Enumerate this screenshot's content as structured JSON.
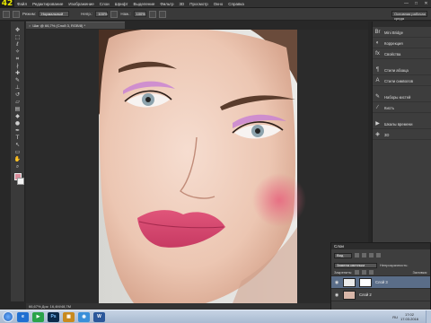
{
  "menubar": {
    "logo": "42",
    "items": [
      "Файл",
      "Редактирование",
      "Изображение",
      "Слои",
      "Шрифт",
      "Выделение",
      "Фильтр",
      "3D",
      "Просмотр",
      "Окно",
      "Справка"
    ],
    "window_buttons": [
      "—",
      "□",
      "✕"
    ]
  },
  "options": {
    "mode_label": "Режим:",
    "mode_value": "Нормальный",
    "opacity_label": "Непр.:",
    "opacity_value": "100%",
    "flow_label": "Наж.:",
    "flow_value": "100%",
    "workspace": "Основная рабочая среда"
  },
  "document": {
    "tab_title": "Шаг @ 66,7% (Слой 3, RGB/8) *",
    "close_glyph": "×",
    "status": "66,67%    Док: 16,4M/48,7M"
  },
  "dock": {
    "panels_top": [
      {
        "icon": "mini-bridge-icon",
        "glyph": "Br",
        "label": "Mini Bridge"
      },
      {
        "icon": "corrections-icon",
        "glyph": "◐",
        "label": "Коррекция"
      },
      {
        "icon": "styles-icon",
        "glyph": "fx",
        "label": "Свойства"
      }
    ],
    "panels_mid": [
      {
        "icon": "paragraph-styles-icon",
        "glyph": "¶",
        "label": "Стили абзаца"
      },
      {
        "icon": "char-styles-icon",
        "glyph": "A",
        "label": "Стили символов"
      }
    ],
    "panels_low": [
      {
        "icon": "brush-presets-icon",
        "glyph": "✎",
        "label": "Наборы кистей"
      },
      {
        "icon": "brush-icon",
        "glyph": "∕",
        "label": "Кисть"
      }
    ],
    "panels_bottom": [
      {
        "icon": "actions-icon",
        "glyph": "▶",
        "label": "Шкалы времени"
      },
      {
        "icon": "3d-icon",
        "glyph": "◈",
        "label": "3D"
      }
    ]
  },
  "layers": {
    "title": "Слои",
    "filter": "Вид",
    "blend_mode": "Замена светлым",
    "opacity_label": "Непрозрачность:",
    "lock_label": "Закрепить:",
    "fill_label": "Заливка:",
    "rows": [
      {
        "name": "Слой 3",
        "active": true
      },
      {
        "name": "Слой 2",
        "active": false
      }
    ]
  },
  "statusbar": {
    "zoom": "66,67%"
  },
  "taskbar": {
    "apps": [
      {
        "glyph": "e",
        "color": "#1f6fd1"
      },
      {
        "glyph": "▶",
        "color": "#2aa34a"
      },
      {
        "glyph": "Ps",
        "color": "#0b2a4a"
      },
      {
        "glyph": "▦",
        "color": "#c88a1e"
      },
      {
        "glyph": "◉",
        "color": "#3a8fd9"
      },
      {
        "glyph": "W",
        "color": "#2b579a"
      }
    ],
    "lang": "RU",
    "time": "17:02",
    "date": "17.03.2016"
  }
}
